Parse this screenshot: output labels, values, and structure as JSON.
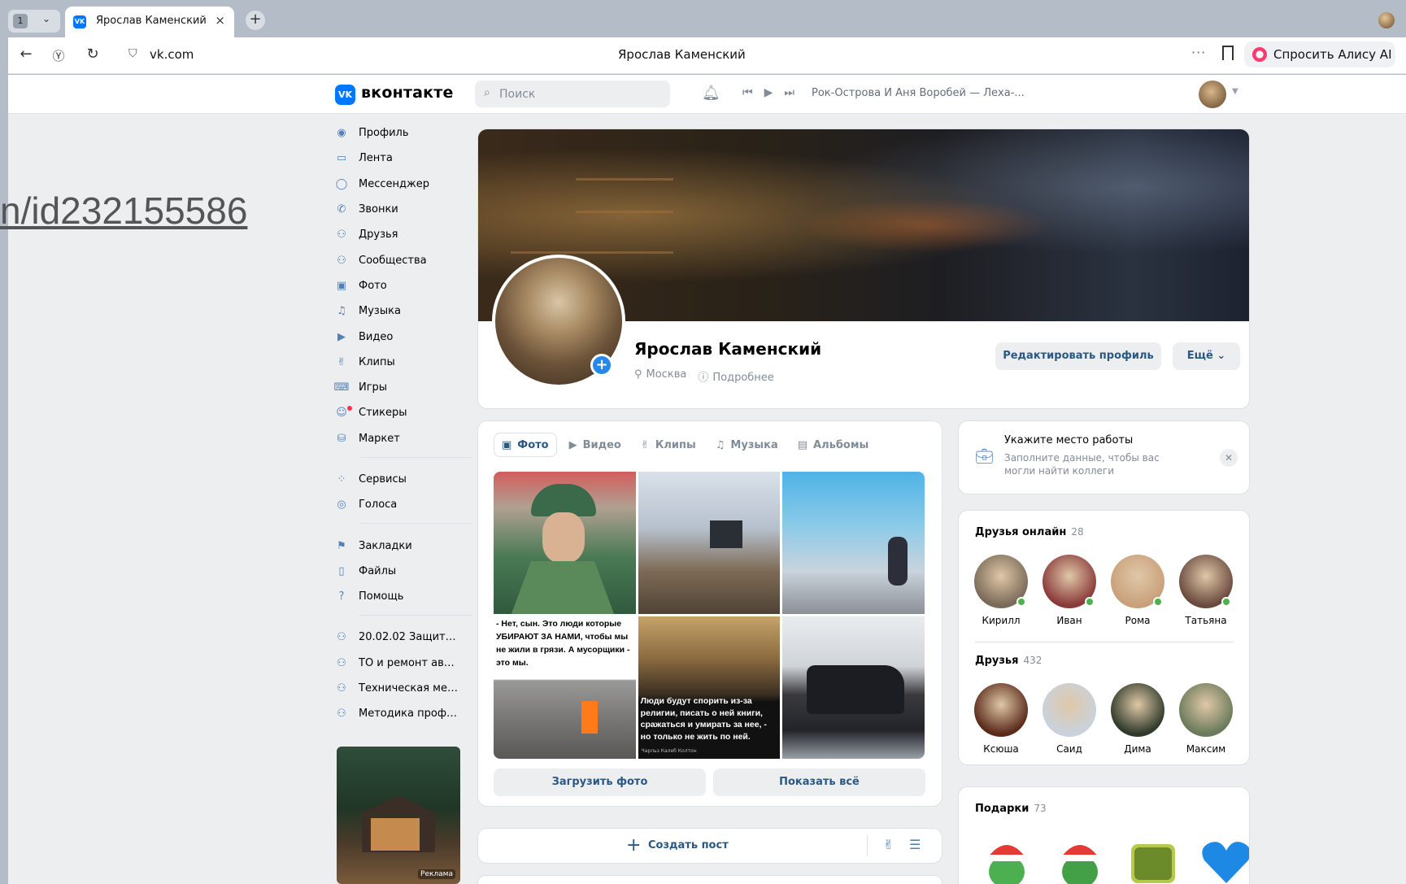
{
  "browser": {
    "tab_count": "1",
    "tab_title": "Ярослав Каменский",
    "url": "vk.com",
    "page_title": "Ярослав Каменский",
    "alice_label": "Спросить Алису AI"
  },
  "vk": {
    "brand": "вконтакте",
    "search_placeholder": "Поиск",
    "now_playing": "Рок-Острова И Аня Воробей — Леха-..."
  },
  "overlay_url_fragment": "n/id232155586",
  "sidebar": {
    "groups": [
      [
        {
          "label": "Профиль",
          "icon": "user-circle-icon"
        },
        {
          "label": "Лента",
          "icon": "feed-icon"
        },
        {
          "label": "Мессенджер",
          "icon": "message-icon"
        },
        {
          "label": "Звонки",
          "icon": "phone-icon"
        },
        {
          "label": "Друзья",
          "icon": "friends-icon"
        },
        {
          "label": "Сообщества",
          "icon": "communities-icon"
        },
        {
          "label": "Фото",
          "icon": "photo-icon"
        },
        {
          "label": "Музыка",
          "icon": "music-icon"
        },
        {
          "label": "Видео",
          "icon": "video-icon"
        },
        {
          "label": "Клипы",
          "icon": "clips-icon"
        },
        {
          "label": "Игры",
          "icon": "gamepad-icon"
        },
        {
          "label": "Стикеры",
          "icon": "sticker-icon"
        },
        {
          "label": "Маркет",
          "icon": "market-bag-icon"
        }
      ],
      [
        {
          "label": "Сервисы",
          "icon": "services-icon"
        },
        {
          "label": "Голоса",
          "icon": "votes-icon"
        }
      ],
      [
        {
          "label": "Закладки",
          "icon": "bookmark-icon"
        },
        {
          "label": "Файлы",
          "icon": "file-icon"
        },
        {
          "label": "Помощь",
          "icon": "help-icon"
        }
      ],
      [
        {
          "label": "20.02.02 Защита в...",
          "icon": "group-icon"
        },
        {
          "label": "ТО и ремонт авто...",
          "icon": "group-icon"
        },
        {
          "label": "Техническая меха...",
          "icon": "group-icon"
        },
        {
          "label": "Методика профес...",
          "icon": "group-icon"
        }
      ]
    ],
    "ad_label": "Реклама"
  },
  "profile": {
    "name": "Ярослав Каменский",
    "city": "Москва",
    "more": "Подробнее",
    "edit_button": "Редактировать профиль",
    "more_button": "Ещё"
  },
  "media": {
    "tabs": [
      {
        "label": "Фото",
        "icon": "photo-icon",
        "active": true
      },
      {
        "label": "Видео",
        "icon": "video-icon",
        "active": false
      },
      {
        "label": "Клипы",
        "icon": "clips-icon",
        "active": false
      },
      {
        "label": "Музыка",
        "icon": "music-icon",
        "active": false
      },
      {
        "label": "Альбомы",
        "icon": "albums-icon",
        "active": false
      }
    ],
    "meme_text": "- Нет, сын. Это люди которые УБИРАЮТ ЗА НАМИ, чтобы мы не жили в грязи. А мусорщики - это мы.",
    "quote_text": "Люди будут спорить из-за религии, писать о ней книги, сражаться и умирать за нее, - но только не жить по ней.",
    "quote_author": "Чарльз Калеб Колтон",
    "upload_button": "Загрузить фото",
    "show_all_button": "Показать всё"
  },
  "post": {
    "create_label": "Создать пост"
  },
  "work": {
    "title": "Укажите место работы",
    "subtitle": "Заполните данные, чтобы вас могли найти коллеги"
  },
  "friends_online": {
    "title": "Друзья онлайн",
    "count": "28",
    "items": [
      {
        "name": "Кирилл",
        "color": "#7a6a58"
      },
      {
        "name": "Иван",
        "color": "#8a3a3a"
      },
      {
        "name": "Рома",
        "color": "#c9a07a"
      },
      {
        "name": "Татьяна",
        "color": "#6a4a3e"
      }
    ]
  },
  "friends": {
    "title": "Друзья",
    "count": "432",
    "items": [
      {
        "name": "Ксюша",
        "color": "#5a2a1a"
      },
      {
        "name": "Саид",
        "color": "#c9d2dc"
      },
      {
        "name": "Дима",
        "color": "#2f3a2a"
      },
      {
        "name": "Максим",
        "color": "#6a7a5a"
      }
    ]
  },
  "gifts": {
    "title": "Подарки",
    "count": "73"
  },
  "colors": {
    "vk_blue": "#0077ff",
    "link": "#2a5885",
    "accent": "#2688eb",
    "online": "#4bb34b"
  }
}
